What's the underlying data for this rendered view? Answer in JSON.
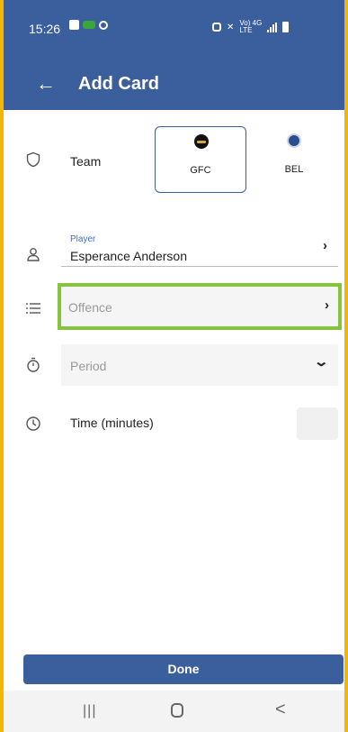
{
  "status_bar": {
    "time": "15:26",
    "icons_left": [
      "image-icon",
      "cast-icon",
      "sync-icon"
    ],
    "network_label_top": "Vo) 4G",
    "network_label_bottom": "LTE"
  },
  "app_bar": {
    "title": "Add Card",
    "back_icon": "arrow-left-icon"
  },
  "team": {
    "label": "Team",
    "options": [
      {
        "code": "GFC",
        "selected": true
      },
      {
        "code": "BEL",
        "selected": false
      }
    ]
  },
  "player": {
    "caption": "Player",
    "value": "Esperance Anderson",
    "chevron": "›"
  },
  "offence": {
    "placeholder": "Offence",
    "chevron": "›"
  },
  "period": {
    "placeholder": "Period",
    "chevron": "⌄"
  },
  "time": {
    "label": "Time (minutes)",
    "value": ""
  },
  "actions": {
    "done_label": "Done"
  },
  "nav_bar": {
    "recents": "|||",
    "back": "<"
  },
  "colors": {
    "primary": "#3a5f9c",
    "highlight": "#86c440",
    "caption": "#3a72c4"
  }
}
